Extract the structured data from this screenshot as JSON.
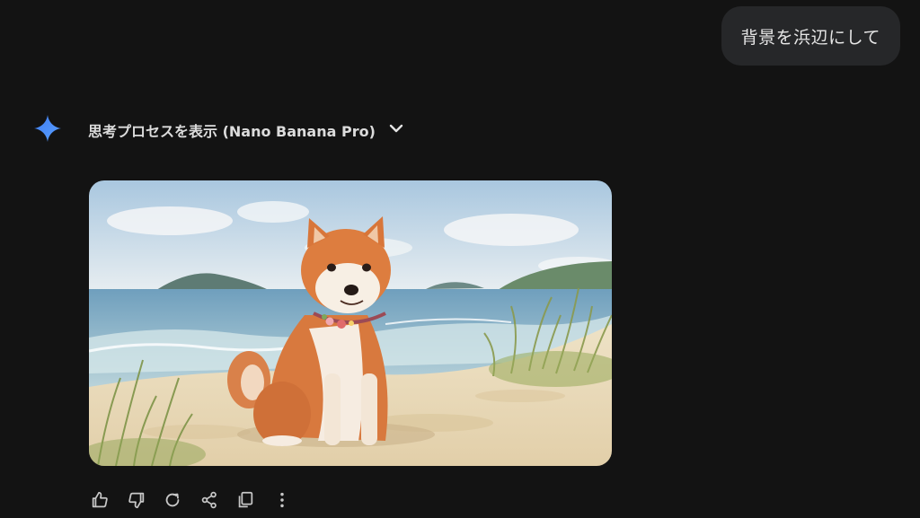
{
  "conversation": {
    "user_message": "背景を浜辺にして",
    "response": {
      "thinking_toggle_label": "思考プロセスを表示 (Nano Banana Pro)",
      "image_subject": "watercolor shiba inu dog sitting on a beach",
      "actions": [
        {
          "name": "thumbs-up",
          "icon": "thumbs-up-icon"
        },
        {
          "name": "thumbs-down",
          "icon": "thumbs-down-icon"
        },
        {
          "name": "regenerate",
          "icon": "refresh-icon"
        },
        {
          "name": "share",
          "icon": "share-icon"
        },
        {
          "name": "copy",
          "icon": "copy-icon"
        },
        {
          "name": "more-options",
          "icon": "more-vertical-icon"
        }
      ]
    }
  },
  "colors": {
    "background": "#131313",
    "bubble": "#262729",
    "sparkle_blue": "#4a8cf7"
  }
}
